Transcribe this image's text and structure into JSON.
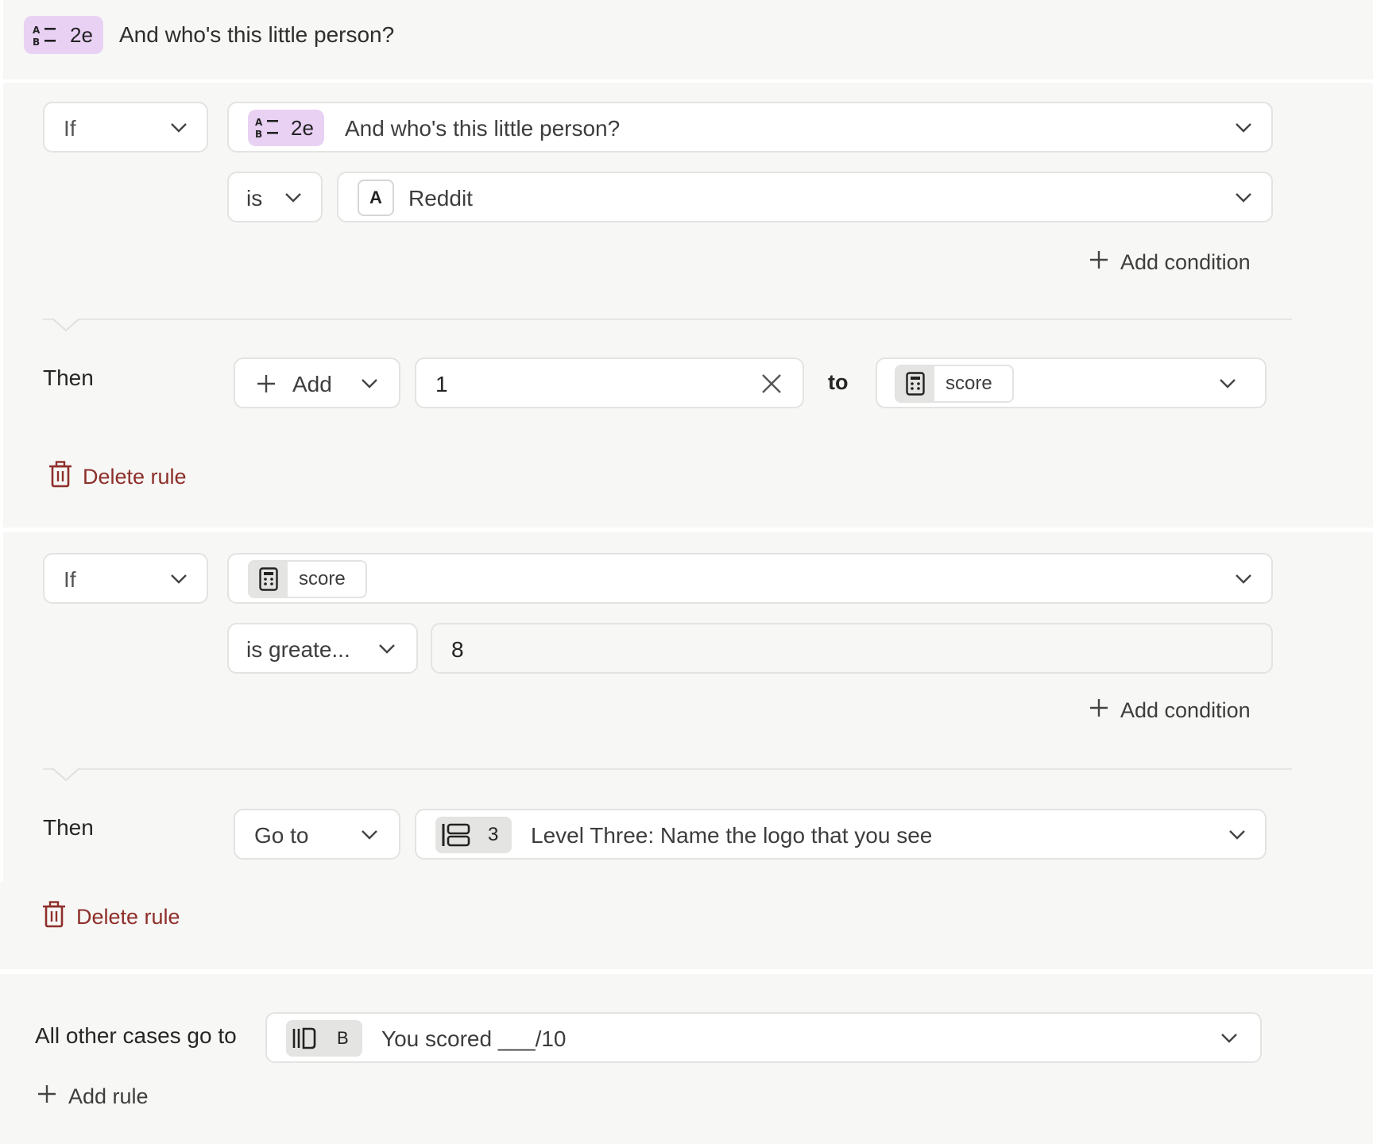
{
  "header": {
    "badge_code": "2e",
    "question": "And who's this little person?"
  },
  "rule1": {
    "if_label": "If",
    "field_badge": "2e",
    "field_text": "And who's this little person?",
    "operator": "is",
    "value_letter": "A",
    "value_text": "Reddit",
    "add_condition": "Add condition",
    "then_label": "Then",
    "action": "Add",
    "amount": "1",
    "to_label": "to",
    "target_variable": "score",
    "delete_rule": "Delete rule"
  },
  "rule2": {
    "if_label": "If",
    "field_variable": "score",
    "operator": "is greate...",
    "value": "8",
    "add_condition": "Add condition",
    "then_label": "Then",
    "action": "Go to",
    "target_badge": "3",
    "target_text": "Level Three: Name the logo that you see",
    "delete_rule": "Delete rule"
  },
  "fallback": {
    "label": "All other cases go to",
    "badge": "B",
    "target_text": "You scored ___/10",
    "add_rule": "Add rule"
  },
  "colors": {
    "panel_bg": "#f7f7f5",
    "badge_purple": "#e9d1f4",
    "delete_red": "#8e2f2a"
  }
}
